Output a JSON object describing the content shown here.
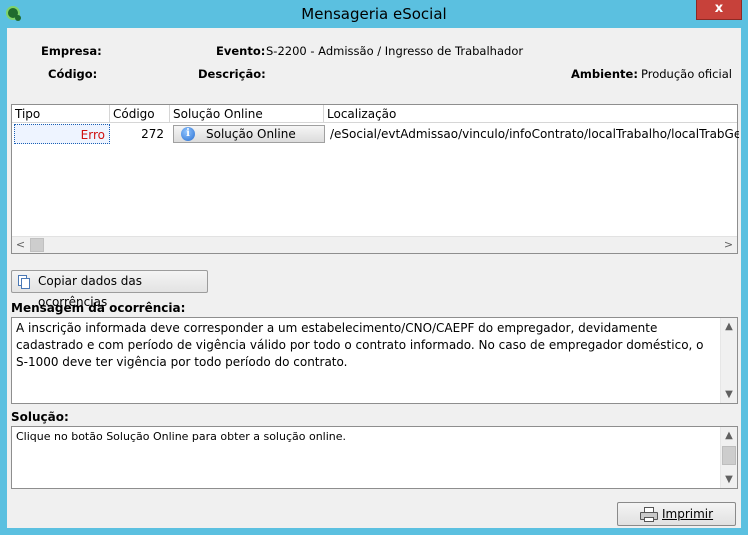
{
  "window": {
    "title": "Mensageria eSocial",
    "close_label": "x"
  },
  "info": {
    "empresa_label": "Empresa:",
    "empresa_value": "",
    "evento_label": "Evento:",
    "evento_value": "S-2200 - Admissão / Ingresso de Trabalhador",
    "codigo_label": "Código:",
    "codigo_value": "",
    "descricao_label": "Descrição:",
    "descricao_value": "",
    "ambiente_label": "Ambiente:",
    "ambiente_value": "Produção oficial"
  },
  "grid": {
    "columns": [
      "Tipo",
      "Código",
      "Solução Online",
      "Localização"
    ],
    "rows": [
      {
        "tipo": "Erro",
        "codigo": "272",
        "solucao_button": "Solução Online",
        "localizacao": "/eSocial/evtAdmissao/vinculo/infoContrato/localTrabalho/localTrabGeral/"
      }
    ],
    "scroll_left": "<",
    "scroll_right": ">"
  },
  "buttons": {
    "copy_label": "Copiar dados das ocorrências",
    "print_label": "Imprimir"
  },
  "mensagem": {
    "label": "Mensagem da ocorrência:",
    "text": "A inscrição informada deve corresponder a um estabelecimento/CNO/CAEPF do empregador, devidamente cadastrado e com período de vigência válido por todo o contrato informado. No caso de empregador doméstico, o S-1000 deve ter vigência por todo período do contrato."
  },
  "solucao": {
    "label": "Solução:",
    "text": "Clique no botão Solução Online para obter a solução online."
  },
  "colors": {
    "titlebar": "#5bc0e0",
    "close": "#c7413a",
    "error_text": "#d01010"
  }
}
